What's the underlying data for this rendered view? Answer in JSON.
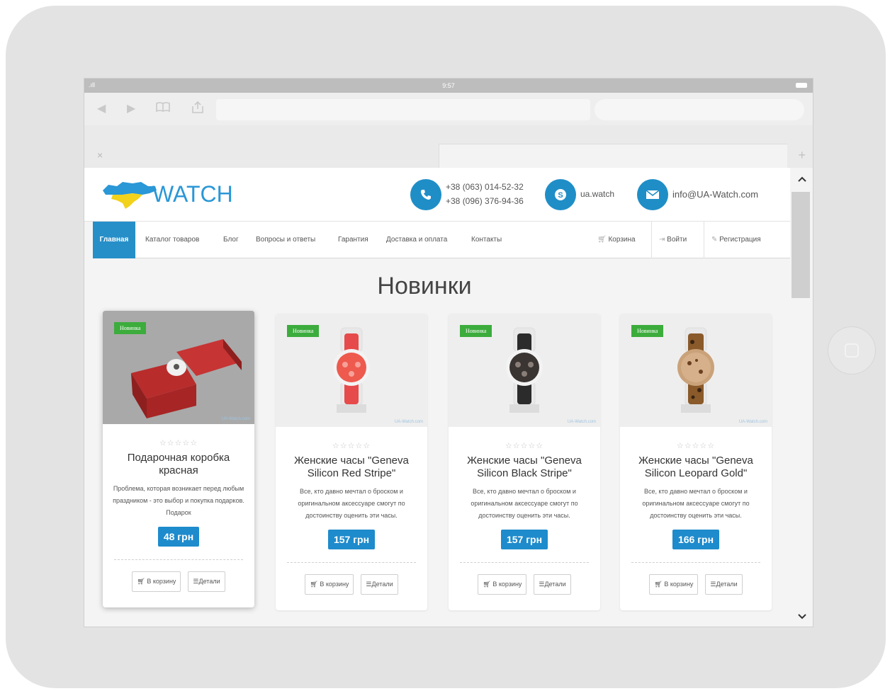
{
  "device": {
    "status": {
      "signal": ".ıll",
      "time": "9:57"
    },
    "browser": {
      "nav": {
        "back_icon": "◀",
        "forward_icon": "▶",
        "bookmarks_icon": "🕮",
        "share_icon": "⇪"
      },
      "tab": {
        "close_icon": "×",
        "new_tab_icon": "+"
      }
    },
    "scroll": {
      "up_icon": "^",
      "down_icon": "v"
    }
  },
  "site": {
    "logo": {
      "text": "WATCH"
    },
    "phones": [
      "+38 (063) 014-52-32",
      "+38 (096) 376-94-36"
    ],
    "skype": "ua.watch",
    "email": "info@UA-Watch.com",
    "nav": {
      "items": [
        "Главная",
        "Каталог товаров",
        "Блог",
        "Вопросы и ответы",
        "Гарантия",
        "Доставка и оплата",
        "Контакты"
      ],
      "cart": "Корзина",
      "login": "Войти",
      "register": "Регистрация"
    },
    "section_title": "Новинки",
    "products": [
      {
        "badge": "Новинка",
        "rating": "☆☆☆☆☆",
        "title": "Подарочная коробка красная",
        "description": "Проблема, которая возникает перед любым праздником - это выбор и покупка подарков. Подарок",
        "price": "48 грн",
        "cart_button": "В корзину",
        "details_button": "Детали",
        "watermark": "UA-Watch.com"
      },
      {
        "badge": "Новинка",
        "rating": "☆☆☆☆☆",
        "title": "Женские часы \"Geneva Silicon Red Stripe\"",
        "description": "Все, кто давно мечтал о броском и оригинальном аксессуаре смогут по достоинству оценить эти часы.",
        "price": "157 грн",
        "cart_button": "В корзину",
        "details_button": "Детали",
        "watermark": "UA-Watch.com"
      },
      {
        "badge": "Новинка",
        "rating": "☆☆☆☆☆",
        "title": "Женские часы \"Geneva Silicon Black Stripe\"",
        "description": "Все, кто давно мечтал о броском и оригинальном аксессуаре смогут по достоинству оценить эти часы.",
        "price": "157 грн",
        "cart_button": "В корзину",
        "details_button": "Детали",
        "watermark": "UA-Watch.com"
      },
      {
        "badge": "Новинка",
        "rating": "☆☆☆☆☆",
        "title": "Женские часы \"Geneva Silicon Leopard Gold\"",
        "description": "Все, кто давно мечтал о броском и оригинальном аксессуаре смогут по достоинству оценить эти часы.",
        "price": "166 грн",
        "cart_button": "В корзину",
        "details_button": "Детали",
        "watermark": "UA-Watch.com"
      }
    ]
  },
  "colors": {
    "accent": "#268fc8",
    "badge": "#3cac3c",
    "price": "#1e8bcc"
  }
}
